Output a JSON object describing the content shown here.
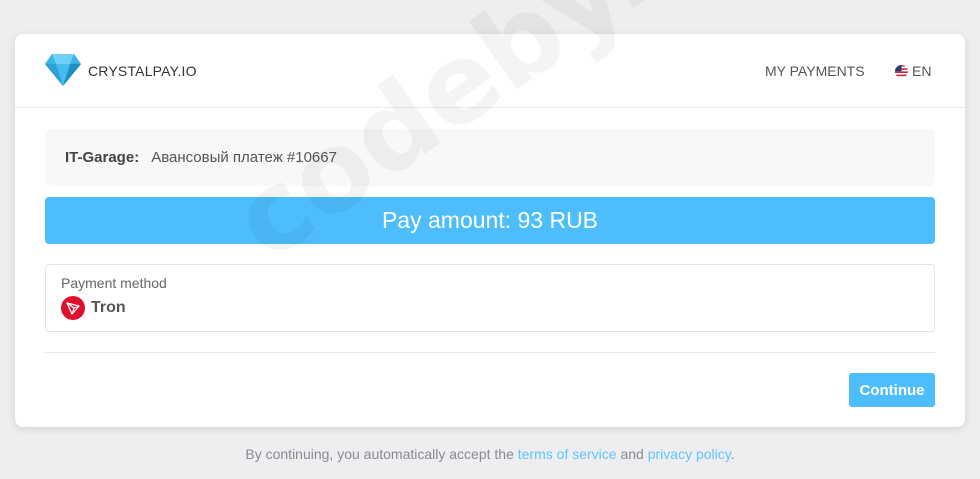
{
  "header": {
    "brand": "CRYSTALPAY.IO",
    "my_payments": "MY PAYMENTS",
    "language": "EN"
  },
  "invoice": {
    "merchant": "IT-Garage:",
    "description": "Авансовый платеж #10667",
    "pay_amount": "Pay amount: 93 RUB"
  },
  "payment_method": {
    "label": "Payment method",
    "value": "Tron"
  },
  "actions": {
    "continue": "Continue"
  },
  "footer": {
    "text_before": "By continuing, you automatically accept the",
    "terms": "terms of service",
    "and": "and",
    "privacy": "privacy policy",
    "end": "."
  },
  "watermark": "codeby.net",
  "colors": {
    "accent": "#4dbefb",
    "tron_red": "#e0102c",
    "link": "#5ac6f8"
  }
}
